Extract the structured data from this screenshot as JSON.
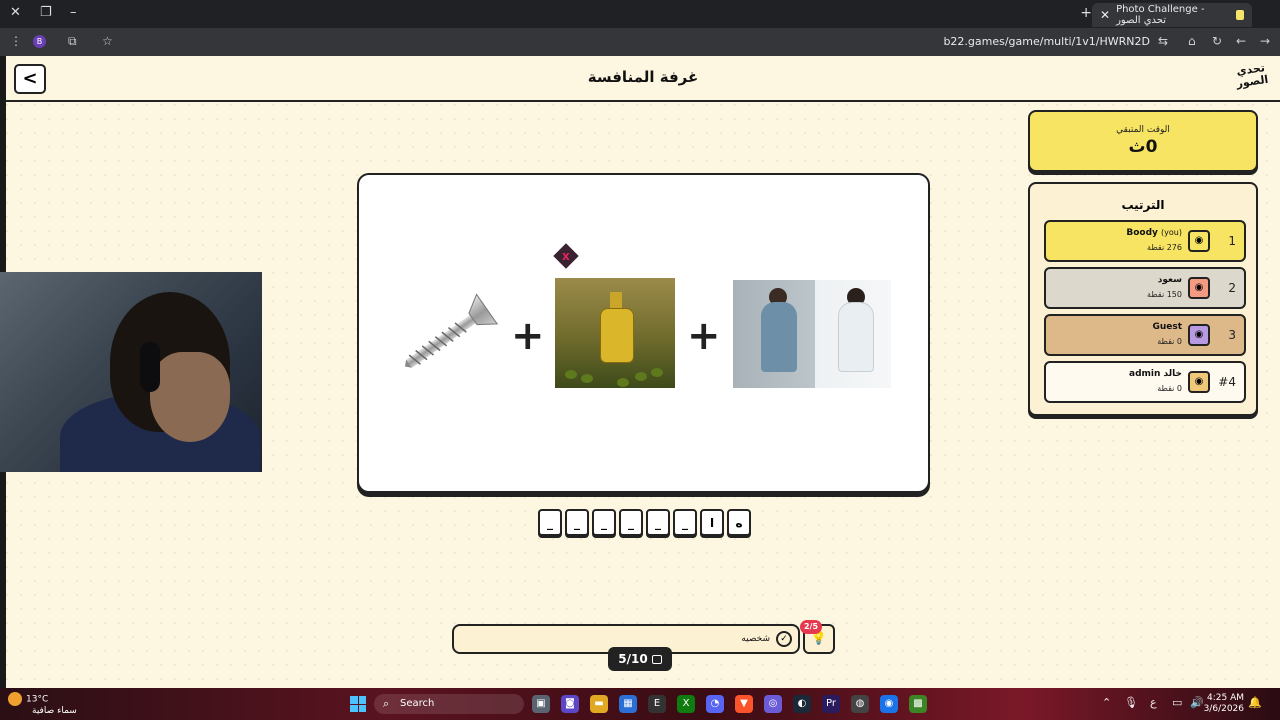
{
  "browser": {
    "tab_title": "Photo Challenge - تحدي الصور",
    "url": "b22.games/game/multi/1v1/HWRN2D",
    "profile_initial": "B"
  },
  "header": {
    "title": "غرفة المنافسة",
    "logo_text": "تحدي الصور",
    "back_label": "<"
  },
  "timer": {
    "label": "الوقت المتبقي",
    "value": "0ث"
  },
  "ranking": {
    "title": "الترتيب",
    "players": [
      {
        "rank": "1",
        "name": "Boody",
        "tag": "(you)",
        "points": "276 نقطة",
        "bg": "#f7e463",
        "avatar_bg": "#f7e463"
      },
      {
        "rank": "2",
        "name": "سعود",
        "tag": "",
        "points": "150 نقطة",
        "bg": "#dcd8cc",
        "avatar_bg": "#f29a82"
      },
      {
        "rank": "3",
        "name": "Guest",
        "tag": "",
        "points": "0 نقطة",
        "bg": "#ddb98a",
        "avatar_bg": "#b89ae0"
      },
      {
        "rank": "#4",
        "name": "خالد admin",
        "tag": "",
        "points": "0 نقطة",
        "bg": "#fffaf0",
        "avatar_bg": "#f0c87a"
      }
    ]
  },
  "puzzle": {
    "images": [
      "screw-image",
      "olive-oil-image",
      "high-five-image"
    ],
    "wrong_mark": "x"
  },
  "letters": [
    "_",
    "_",
    "_",
    "_",
    "_",
    "_",
    "ا",
    "ه"
  ],
  "hint": {
    "text": "شخصيه",
    "remaining": "2/5"
  },
  "progress": "5/10",
  "taskbar": {
    "temperature": "13°C",
    "weather": "سماء صافية",
    "search": "Search",
    "time": "4:25 AM",
    "date": "3/6/2026",
    "lang": "ع"
  }
}
